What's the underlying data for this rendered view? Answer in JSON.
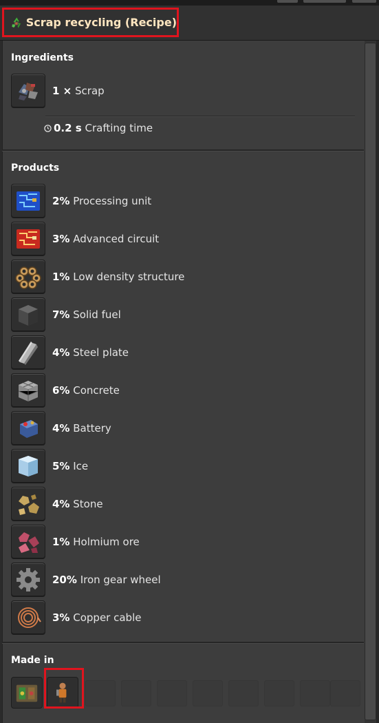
{
  "title": {
    "text": "Scrap recycling (Recipe)",
    "icon": "recycling-icon"
  },
  "ingredients": {
    "heading": "Ingredients",
    "items": [
      {
        "amount": "1 ×",
        "name": "Scrap",
        "icon": "scrap-icon"
      }
    ],
    "crafting_time_value": "0.2 s",
    "crafting_time_label": "Crafting time"
  },
  "products": {
    "heading": "Products",
    "items": [
      {
        "amount": "2%",
        "name": "Processing unit",
        "icon": "processing-unit-icon"
      },
      {
        "amount": "3%",
        "name": "Advanced circuit",
        "icon": "advanced-circuit-icon"
      },
      {
        "amount": "1%",
        "name": "Low density structure",
        "icon": "low-density-structure-icon"
      },
      {
        "amount": "7%",
        "name": "Solid fuel",
        "icon": "solid-fuel-icon"
      },
      {
        "amount": "4%",
        "name": "Steel plate",
        "icon": "steel-plate-icon"
      },
      {
        "amount": "6%",
        "name": "Concrete",
        "icon": "concrete-icon"
      },
      {
        "amount": "4%",
        "name": "Battery",
        "icon": "battery-icon"
      },
      {
        "amount": "5%",
        "name": "Ice",
        "icon": "ice-icon"
      },
      {
        "amount": "4%",
        "name": "Stone",
        "icon": "stone-icon"
      },
      {
        "amount": "1%",
        "name": "Holmium ore",
        "icon": "holmium-ore-icon"
      },
      {
        "amount": "20%",
        "name": "Iron gear wheel",
        "icon": "iron-gear-wheel-icon"
      },
      {
        "amount": "3%",
        "name": "Copper cable",
        "icon": "copper-cable-icon"
      }
    ]
  },
  "made_in": {
    "heading": "Made in",
    "machines": [
      {
        "icon": "recycler-icon"
      },
      {
        "icon": "engineer-character-icon"
      }
    ]
  },
  "colors": {
    "highlight": "#e0141e",
    "title_text": "#ffe6c0",
    "panel_bg": "#3d3d3d"
  }
}
